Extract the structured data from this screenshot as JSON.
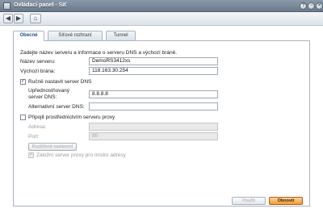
{
  "window": {
    "title": "Ovládací panel - Síť",
    "help_glyph": "?",
    "minimize_glyph": "−",
    "close_glyph": "×"
  },
  "toolbar": {
    "back_glyph": "◀",
    "forward_glyph": "▶",
    "home_glyph": "⌂"
  },
  "tabs": [
    {
      "label": "Obecné",
      "active": true
    },
    {
      "label": "Síťové rozhraní",
      "active": false
    },
    {
      "label": "Tunnel",
      "active": false
    }
  ],
  "general": {
    "intro": "Zadejte název serveru a informace o serveru DNS a výchozí bráně.",
    "server_name_label": "Název serveru:",
    "server_name_value": "DemoRS3412xs",
    "gateway_label": "Výchozí brána:",
    "gateway_value": "118.163.30.254"
  },
  "dns": {
    "manual_label": "Ručně nastavit server DNS",
    "manual_checked": true,
    "preferred_label_line1": "Upřednostňovaný",
    "preferred_label_line2": "server DNS:",
    "preferred_value": "8.8.8.8",
    "alternative_label": "Alternativní server DNS:",
    "alternative_value": ""
  },
  "proxy": {
    "enable_label": "Připojit prostřednictvím serveru proxy",
    "enable_checked": false,
    "address_label": "Adresa:",
    "address_value": "",
    "port_label": "Port:",
    "port_value": "80",
    "advanced_button": "Rozšířené nastavení",
    "bypass_label": "Záložní server proxy pro místní adresy",
    "bypass_checked": true
  },
  "footer": {
    "apply_label": "Použít",
    "reset_label": "Obnovit"
  },
  "colors": {
    "titlebar": "#6b7b8c",
    "accent_button": "#f39a33",
    "active_tab_text": "#1b4f8a"
  }
}
